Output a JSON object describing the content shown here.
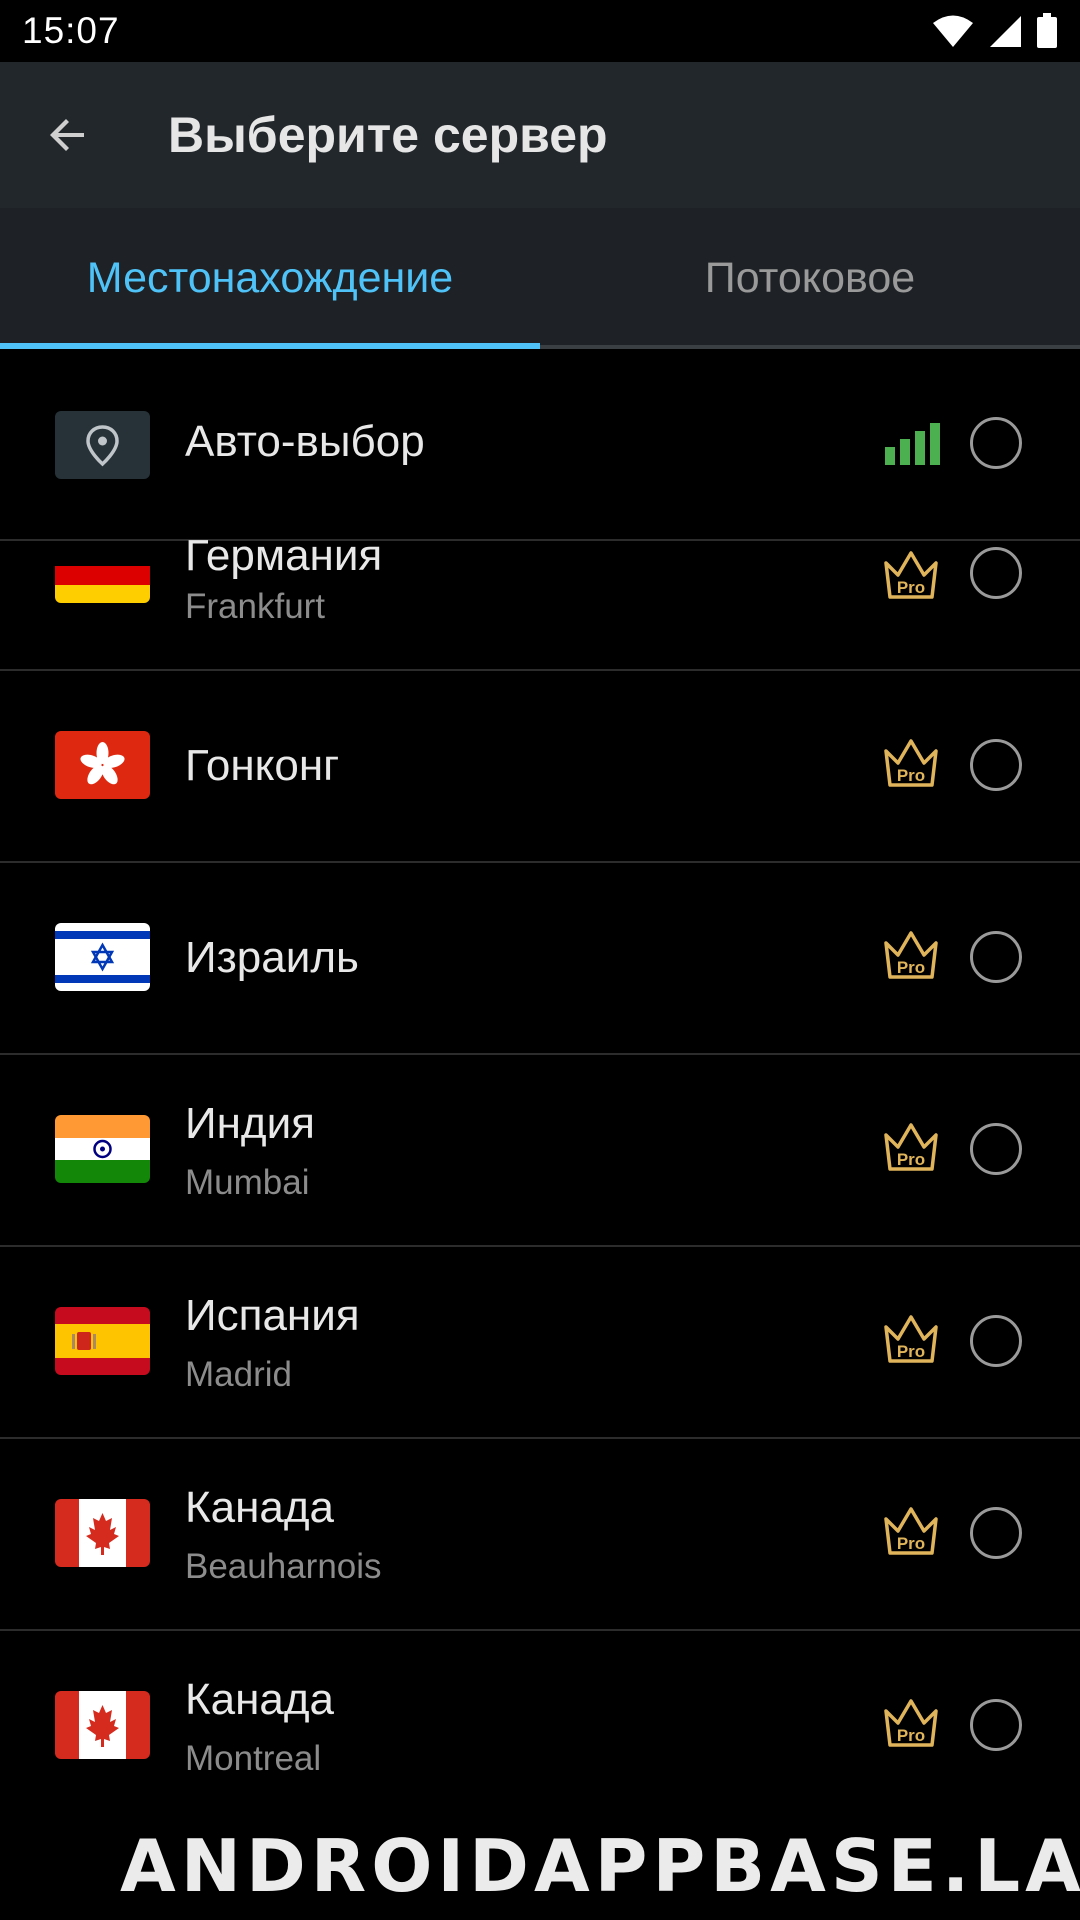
{
  "status_bar": {
    "time": "15:07",
    "icons": [
      "wifi-icon",
      "cell-signal-icon",
      "battery-icon"
    ]
  },
  "app_bar": {
    "title": "Выберите сервер",
    "back_icon": "arrow-back-icon"
  },
  "tabs": [
    {
      "label": "Местонахождение",
      "active": true
    },
    {
      "label": "Потоковое",
      "active": false
    }
  ],
  "servers": [
    {
      "title": "Авто-выбор",
      "subtitle": "",
      "flag": "location-pin",
      "badge": "signal"
    },
    {
      "title": "Германия",
      "subtitle": "Frankfurt",
      "flag": "germany",
      "badge": "Pro"
    },
    {
      "title": "Гонконг",
      "subtitle": "",
      "flag": "hong-kong",
      "badge": "Pro"
    },
    {
      "title": "Израиль",
      "subtitle": "",
      "flag": "israel",
      "badge": "Pro"
    },
    {
      "title": "Индия",
      "subtitle": "Mumbai",
      "flag": "india",
      "badge": "Pro"
    },
    {
      "title": "Испания",
      "subtitle": "Madrid",
      "flag": "spain",
      "badge": "Pro"
    },
    {
      "title": "Канада",
      "subtitle": "Beauharnois",
      "flag": "canada",
      "badge": "Pro"
    },
    {
      "title": "Канада",
      "subtitle": "Montreal",
      "flag": "canada",
      "badge": "Pro"
    }
  ],
  "colors": {
    "accent": "#4fc3f7",
    "pro_gold": "#e0b45a",
    "signal_green": "#4caf50"
  },
  "watermark": "ANDROIDAPPBASE.LAT"
}
